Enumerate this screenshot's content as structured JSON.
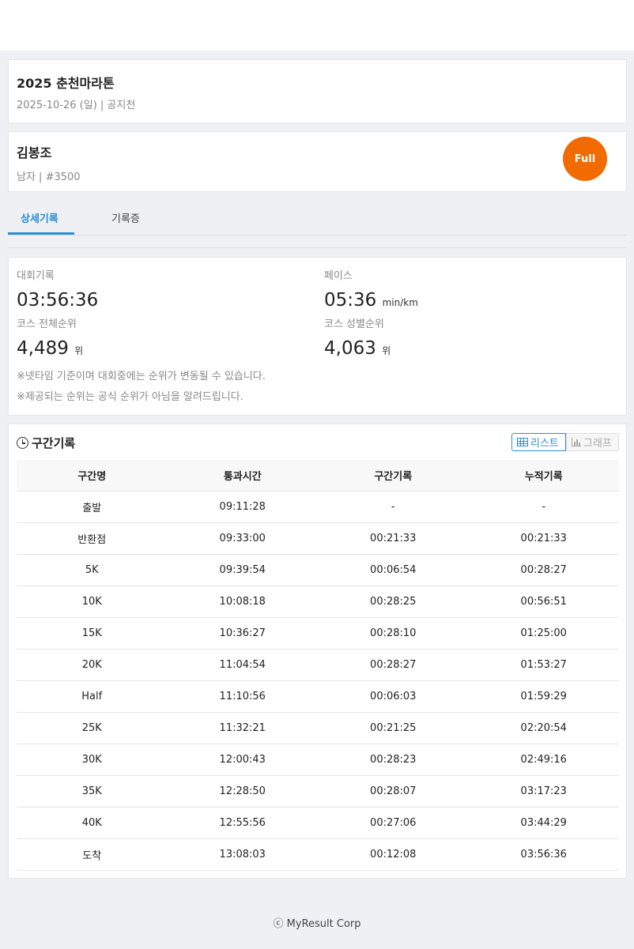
{
  "event": {
    "title": "2025 춘천마라톤",
    "subtitle": "2025-10-26 (일) | 공지천"
  },
  "runner": {
    "name": "김봉조",
    "subtitle": "남자 | #3500",
    "course_badge": "Full"
  },
  "tabs": [
    {
      "label": "상세기록",
      "active": true
    },
    {
      "label": "기록증",
      "active": false
    }
  ],
  "record": {
    "finish_label": "대회기록",
    "finish_time": "03:56:36",
    "pace_label": "페이스",
    "pace_value": "05:36",
    "pace_unit": "min/km",
    "overall_rank_label": "코스 전체순위",
    "overall_rank": "4,489",
    "rank_unit": "위",
    "gender_rank_label": "코스 성별순위",
    "gender_rank": "4,063",
    "note1": "※넷타임 기준이며 대회중에는 순위가 변동될 수 있습니다.",
    "note2": "※제공되는 순위는 공식 순위가 아님을 알려드립니다."
  },
  "splits": {
    "title": "구간기록",
    "view_list_label": "리스트",
    "view_graph_label": "그래프",
    "columns": [
      "구간명",
      "통과시간",
      "구간기록",
      "누적기록"
    ],
    "rows": [
      [
        "출발",
        "09:11:28",
        "-",
        "-"
      ],
      [
        "반환점",
        "09:33:00",
        "00:21:33",
        "00:21:33"
      ],
      [
        "5K",
        "09:39:54",
        "00:06:54",
        "00:28:27"
      ],
      [
        "10K",
        "10:08:18",
        "00:28:25",
        "00:56:51"
      ],
      [
        "15K",
        "10:36:27",
        "00:28:10",
        "01:25:00"
      ],
      [
        "20K",
        "11:04:54",
        "00:28:27",
        "01:53:27"
      ],
      [
        "Half",
        "11:10:56",
        "00:06:03",
        "01:59:29"
      ],
      [
        "25K",
        "11:32:21",
        "00:21:25",
        "02:20:54"
      ],
      [
        "30K",
        "12:00:43",
        "00:28:23",
        "02:49:16"
      ],
      [
        "35K",
        "12:28:50",
        "00:28:07",
        "03:17:23"
      ],
      [
        "40K",
        "12:55:56",
        "00:27:06",
        "03:44:29"
      ],
      [
        "도착",
        "13:08:03",
        "00:12:08",
        "03:56:36"
      ]
    ]
  },
  "footer": {
    "copyright_symbol": "ⓒ",
    "text": "MyResult Corp"
  },
  "colors": {
    "accent": "#2b8fd6",
    "badge": "#f26b00"
  }
}
